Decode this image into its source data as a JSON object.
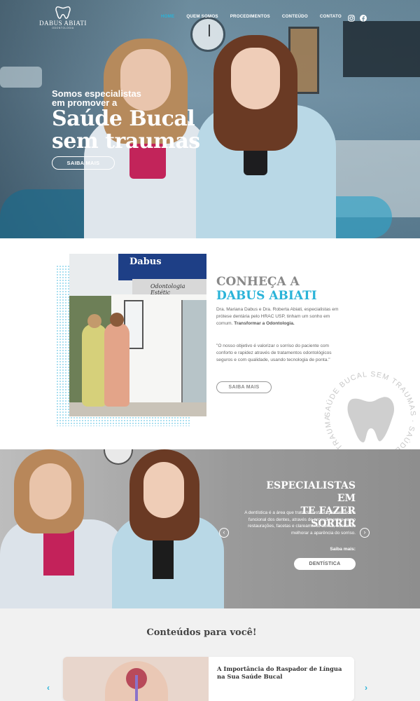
{
  "nav": {
    "logo_name": "DABUS ABIATI",
    "logo_sub": "ODONTOLOGIA",
    "items": [
      {
        "label": "HOME",
        "active": true
      },
      {
        "label": "QUEM SOMOS",
        "active": false
      },
      {
        "label": "PROCEDIMENTOS",
        "active": false
      },
      {
        "label": "CONTEÚDO",
        "active": false
      },
      {
        "label": "CONTATO",
        "active": false
      }
    ],
    "social": [
      "instagram-icon",
      "facebook-icon"
    ]
  },
  "hero": {
    "line1": "Somos especialistas",
    "line2": "em promover a",
    "big1": "Saúde Bucal",
    "big2": "sem traumas",
    "button": "SAIBA MAIS"
  },
  "about": {
    "title_a": "CONHEÇA A",
    "title_b": "DABUS ABIATI",
    "photo_sign": "Dabus",
    "photo_sign2": "Odontologia Estétic",
    "p1_text": "Dra. Mariana Dabus e Dra. Roberta Abiati, especialistas em prótese dentária pelo HRAC USP, tinham um sonho em comum. ",
    "p1_bold": "Transformar a Odontologia.",
    "p2": "\"O nosso objetivo é valorizar o sorriso do paciente com conforto e rapidez através de tratamentos odontológicos seguros e com qualidade, usando tecnologia de ponta.\"",
    "button": "SAIBA MAIS",
    "seal_text": "SAÚDE BUCAL SEM TRAUMAS · SAÚDE BUCAL SEM TRAUMAS ·"
  },
  "specialists": {
    "title1": "ESPECIALISTAS EM",
    "title2": "TE FAZER SORRIR",
    "paragraph": "A dentística é a área que trata da restauração estética e funcional dos dentes, através de procedimentos como restaurações, facetas e clareamento dental, buscando melhorar a aparência do sorriso.",
    "more": "Saiba mais:",
    "button": "DENTÍSTICA",
    "prev": "‹",
    "next": "›"
  },
  "content": {
    "title": "Conteúdos para você!",
    "card_title": "A Importância do Raspador de Língua na Sua Saúde Bucal",
    "prev": "‹",
    "next": "›"
  },
  "colors": {
    "accent": "#2ab3d8",
    "gray_text": "#666666",
    "section_bg": "#f1f1f1"
  }
}
